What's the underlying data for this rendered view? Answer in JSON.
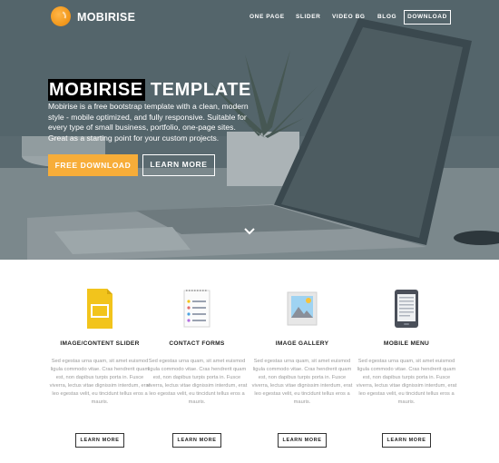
{
  "nav": {
    "brand": "MOBIRISE",
    "links": [
      "ONE PAGE",
      "SLIDER",
      "VIDEO BG",
      "BLOG"
    ],
    "download": "DOWNLOAD"
  },
  "hero": {
    "title_highlight": "MOBIRISE",
    "title_rest": " TEMPLATE",
    "text": "Mobirise is a free bootstrap template with a clean, modern style - mobile optimized, and fully responsive. Suitable for every type of small business, portfolio, one-page sites. Great as a starting point for your custom projects.",
    "primary_button": "FREE DOWNLOAD",
    "secondary_button": "LEARN MORE"
  },
  "features": [
    {
      "icon": "document-icon",
      "title": "IMAGE/CONTENT SLIDER",
      "text": "Sed egestas urna quam, sit amet euismod ligula commodo vitae. Cras hendrerit quam est, non dapibus turpis porta in. Fusce viverra, lectus vitae dignissim interdum, erat leo egestas velit, eu tincidunt tellus eros a mauris.",
      "button": "LEARN MORE"
    },
    {
      "icon": "list-icon",
      "title": "CONTACT FORMS",
      "text": "Sed egestas urna quam, sit amet euismod ligula commodo vitae. Cras hendrerit quam est, non dapibus turpis porta in. Fusce viverra, lectus vitae dignissim interdum, erat leo egestas velit, eu tincidunt tellus eros a mauris.",
      "button": "LEARN MORE"
    },
    {
      "icon": "image-icon",
      "title": "IMAGE GALLERY",
      "text": "Sed egestas urna quam, sit amet euismod ligula commodo vitae. Cras hendrerit quam est, non dapibus turpis porta in. Fusce viverra, lectus vitae dignissim interdum, erat leo egestas velit, eu tincidunt tellus eros a mauris.",
      "button": "LEARN MORE"
    },
    {
      "icon": "ebook-reader-icon",
      "title": "MOBILE MENU",
      "text": "Sed egestas urna quam, sit amet euismod ligula commodo vitae. Cras hendrerit quam est, non dapibus turpis porta in. Fusce viverra, lectus vitae dignissim interdum, erat leo egestas velit, eu tincidunt tellus eros a mauris.",
      "button": "LEARN MORE"
    }
  ],
  "colors": {
    "accent": "#f7ad39",
    "dark": "#222222",
    "muted_text": "#9a9a9a"
  }
}
